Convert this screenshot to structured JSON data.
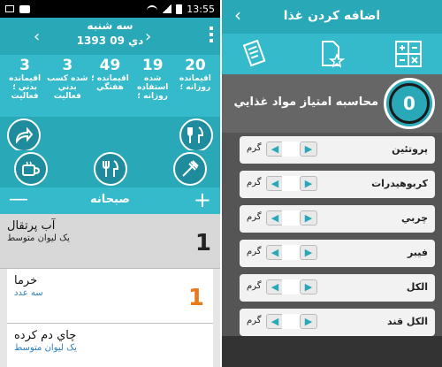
{
  "statusbar": {
    "time": "13:55"
  },
  "left": {
    "header": {
      "day": "سه شنبه",
      "date": "1393 دي 09",
      "prev_arrow": "‹",
      "next_arrow": "›"
    },
    "stats": [
      {
        "value": "20",
        "label": "اقيمانده روزانه ؛"
      },
      {
        "value": "19",
        "label": "شده استفاده روزانه ؛"
      },
      {
        "value": "49",
        "label": "اقيمانده ؛ هفتگي"
      },
      {
        "value": "3",
        "label": "شده كسب بدني فعاليت"
      },
      {
        "value": "3",
        "label": "اقيمانده بدني ؛ فعاليت"
      }
    ],
    "meal": {
      "title": "صبحانه",
      "minus": "—",
      "plus": "+"
    },
    "foods": [
      {
        "name": "آب پرتقال",
        "portion": "يک ليوان متوسط",
        "qty": "1",
        "selected": true
      },
      {
        "name": "خرما",
        "portion": "سه عدد",
        "qty": "1",
        "selected": false
      },
      {
        "name": "چاي دم كرده",
        "portion": "يک ليوان متوسط",
        "qty": "",
        "selected": false
      }
    ]
  },
  "right": {
    "header": {
      "title": "اضافه كردن غذا",
      "back": "‹"
    },
    "score": {
      "value": "0",
      "label": "محاسبه امتياز مواد غذايي"
    },
    "nutrients": [
      {
        "label": "پروتئين",
        "unit": "گرم"
      },
      {
        "label": "كربوهيدرات",
        "unit": "گرم"
      },
      {
        "label": "چربي",
        "unit": "گرم"
      },
      {
        "label": "فيبر",
        "unit": "گرم"
      },
      {
        "label": "الكل",
        "unit": "گرم"
      },
      {
        "label": "الكل قند",
        "unit": "گرم"
      }
    ]
  },
  "colors": {
    "accent": "#29a8b8",
    "accent_light": "#35bacb",
    "qty_dark": "#222222",
    "qty_orange": "#e87a1e",
    "portion_blue": "#2a7fc0"
  },
  "icons": [
    "share-icon",
    "cutlery-icon",
    "cup-icon",
    "fork-knife-icon",
    "hand-fork-icon",
    "receipt-icon",
    "document-star-icon",
    "calculator-icon"
  ]
}
